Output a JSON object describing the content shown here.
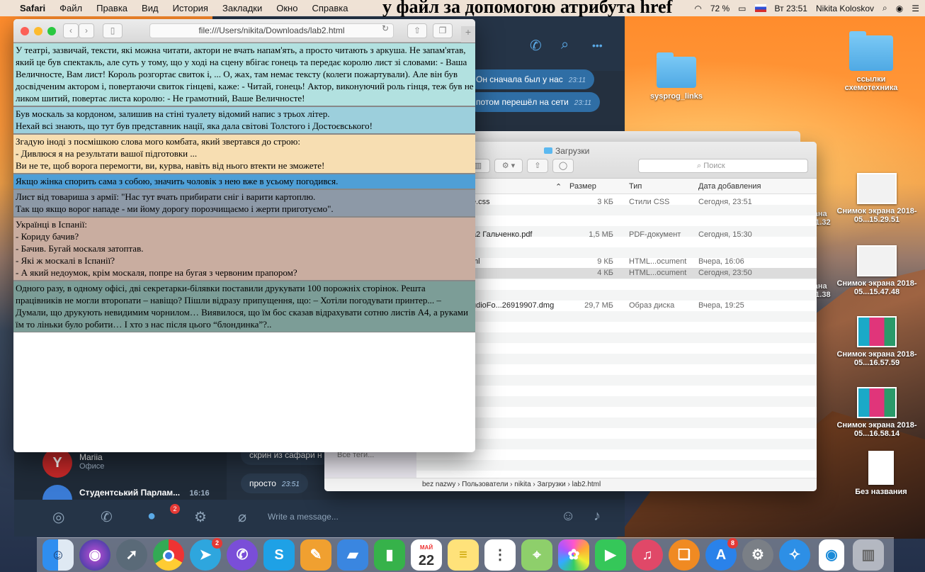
{
  "page_heading": "у файл за допомогою атрибута href",
  "menubar": {
    "apple": "",
    "app": "Safari",
    "items": [
      "Файл",
      "Правка",
      "Вид",
      "История",
      "Закладки",
      "Окно",
      "Справка"
    ],
    "battery": "72 %",
    "clock": "Вт 23:51",
    "user": "Nikita Koloskov"
  },
  "safari": {
    "url": "file:///Users/nikita/Downloads/lab2.html",
    "blocks": [
      {
        "bg": "#b2e1e0",
        "lines": [
          "У театрі, зазвичай, тексти, які можна читати, актори не вчать напам'ять, а просто читають з аркуша. Не запам'ятав, який це був спектакль, але суть у тому, що у ході на сцену вбігає гонець та передає королю лист зі словами: - Ваша Величносте, Вам лист! Король розгортає свиток і, ... О, жах, там немає тексту (колеги пожартували). Але він був досвідченим актором і, повертаючи свиток гінцеві, каже: - Читай, гонець! Актор, виконуючий роль гінця, теж був не ликом шитий, повертає листа королю: - Не грамотний, Ваше Величносте!"
        ]
      },
      {
        "bg": "#9ccfdc",
        "lines": [
          "Був москаль за кордоном, залишив на стіні туалету відомий напис з трьох літер.",
          "Нехай всі знають, що тут був представник нації, яка дала світові Толстого і Достоєвського!"
        ]
      },
      {
        "bg": "#f7deb2",
        "lines": [
          "Згадую іноді з посмішкою слова мого комбата, який звертався до строю:",
          "- Дивлюся я на результати вашої підготовки ...",
          "Ви не те, щоб ворога перемогти, ви, курва, навіть від нього втекти не зможете!"
        ]
      },
      {
        "bg": "#4f9fd6",
        "lines": [
          "Якщо жінка спорить сама з собою, значить чоловік з нею вже в усьому погодився."
        ]
      },
      {
        "bg": "#8d99a7",
        "lines": [
          "Лист від товариша з армії: \"Нас тут вчать прибирати сніг і варити картоплю.",
          "Так що якщо ворог нападе - ми йому дорогу порозчищаємо і жерти приготуємо\"."
        ]
      },
      {
        "bg": "#c9ada0",
        "lines": [
          "Українці в Іспанії:",
          "- Кориду бачив?",
          "- Бачив. Бугай москаля затоптав.",
          "- Які ж москалі в Іспанії?",
          "- А який недоумок, крім москаля, попре на бугая з червоним прапором?"
        ]
      },
      {
        "bg": "#7c9d97",
        "lines": [
          "Одного разу, в одному офісі, дві секретарки-білявки поставили друкувати 100 порожніх сторінок. Решта працівників не могли второпати – навіщо? Пішли відразу припущення, що: – Хотіли погодувати принтер... – Думали, що друкують невидимим чорнилом… Виявилося, що їм бос сказав відрахувати сотню листів А4, а руками їм то ліньки було робити… І хто з нас після цього “блондинка”?.."
        ]
      }
    ]
  },
  "telegram": {
    "bubbles": [
      {
        "text": "Он сначала был у нас",
        "time": "23:11"
      },
      {
        "text": "потом перешёл на сети",
        "time": "23:11"
      }
    ],
    "chats": [
      {
        "name": "Mariia",
        "sub": "Офисе"
      },
      {
        "name": "Студентський Парлам...",
        "time": "16:16"
      }
    ],
    "msg_bottom": [
      {
        "text": "скрин из сафари н"
      },
      {
        "text": "просто",
        "time": "23:51"
      }
    ],
    "input_placeholder": "Write a message...",
    "badge": "2"
  },
  "finder": {
    "title": "Загрузки",
    "search_placeholder": "Поиск",
    "columns": {
      "size": "Размер",
      "type": "Тип",
      "date": "Дата добавления"
    },
    "rows": [
      {
        "name": "e.css",
        "size": "3 КБ",
        "type": "Стили CSS",
        "date": "Сегодня, 23:51"
      },
      {
        "name": "a2 Гальченко.pdf",
        "size": "1,5 МБ",
        "type": "PDF-документ",
        "date": "Сегодня, 15:30"
      },
      {
        "name": "ml",
        "size": "9 КБ",
        "type": "HTML...ocument",
        "date": "Вчера, 16:06"
      },
      {
        "name": "l",
        "size": "4 КБ",
        "type": "HTML...ocument",
        "date": "Сегодня, 23:50"
      },
      {
        "name": "udioFo...26919907.dmg",
        "size": "29,7 МБ",
        "type": "Образ диска",
        "date": "Вчера, 19:25"
      }
    ],
    "path": "bez nazwy  ›  Пользователи  ›  nikita  ›  Загрузки  ›  lab2.html",
    "sidebar_tag": "Все теги..."
  },
  "desktop": {
    "icons": [
      {
        "label": "sysprog_links"
      },
      {
        "label": "ссылки схемотехника"
      },
      {
        "label": "Снимок экрана 2018-05...15.29.51"
      },
      {
        "label": "рана .51.32"
      },
      {
        "label": "Снимок экрана 2018-05...15.47.48"
      },
      {
        "label": "рана .51.38"
      },
      {
        "label": "Снимок экрана 2018-05...16.57.59"
      },
      {
        "label": "Снимок экрана 2018-05...16.58.14"
      },
      {
        "label": "Без названия"
      }
    ]
  },
  "dock": {
    "calendar_month": "МАЙ",
    "calendar_day": "22",
    "telegram_badge": "2",
    "appstore_badge": "8"
  }
}
